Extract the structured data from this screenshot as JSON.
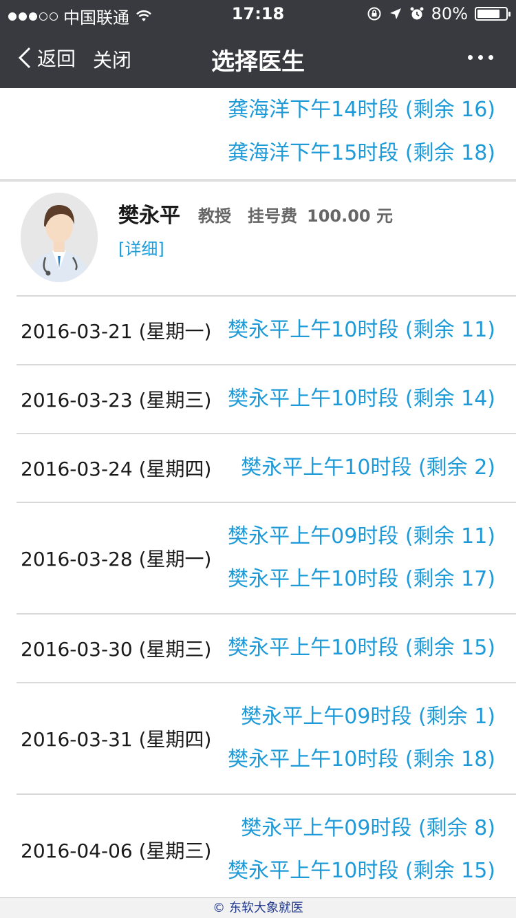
{
  "status": {
    "carrier": "中国联通",
    "time": "17:18",
    "battery": "80%",
    "battery_level": 0.8
  },
  "nav": {
    "back": "返回",
    "close": "关闭",
    "title": "选择医生"
  },
  "prev_doctor_slots": [
    "龚海洋下午14时段 (剩余 16)",
    "龚海洋下午15时段 (剩余 18)"
  ],
  "doctor": {
    "name": "樊永平",
    "title": "教授",
    "fee_label": "挂号费",
    "fee": "100.00 元",
    "detail": "[详细]"
  },
  "schedule": [
    {
      "date": "2016-03-21 (星期一)",
      "slots": [
        "樊永平上午10时段 (剩余 11)"
      ]
    },
    {
      "date": "2016-03-23 (星期三)",
      "slots": [
        "樊永平上午10时段 (剩余 14)"
      ]
    },
    {
      "date": "2016-03-24 (星期四)",
      "slots": [
        "樊永平上午10时段 (剩余 2)"
      ]
    },
    {
      "date": "2016-03-28 (星期一)",
      "slots": [
        "樊永平上午09时段 (剩余 11)",
        "樊永平上午10时段 (剩余 17)"
      ]
    },
    {
      "date": "2016-03-30 (星期三)",
      "slots": [
        "樊永平上午10时段 (剩余 15)"
      ]
    },
    {
      "date": "2016-03-31 (星期四)",
      "slots": [
        "樊永平上午09时段 (剩余 1)",
        "樊永平上午10时段 (剩余 18)"
      ]
    },
    {
      "date": "2016-04-06 (星期三)",
      "slots": [
        "樊永平上午09时段 (剩余 8)",
        "樊永平上午10时段 (剩余 15)"
      ]
    }
  ],
  "footer": "© 东软大象就医",
  "colors": {
    "nav_bg": "#393a3f",
    "link": "#1d9ad7",
    "footer_text": "#233a8f"
  }
}
